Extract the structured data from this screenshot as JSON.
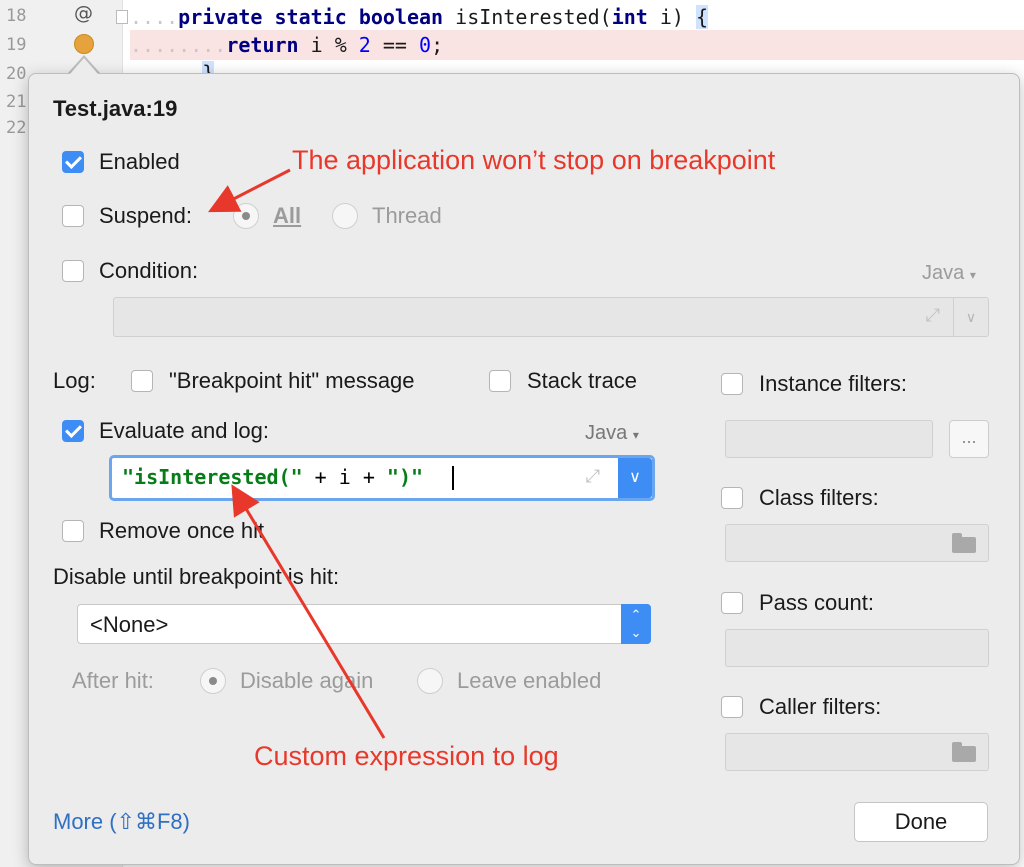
{
  "editor": {
    "line_numbers": [
      "18",
      "19",
      "20",
      "21",
      "22"
    ],
    "line18": {
      "kw1": "private",
      "kw2": "static",
      "kw3": "boolean",
      "name": "isInterested(",
      "kw4": "int",
      "rest": " i)",
      "brace": "{"
    },
    "line19": {
      "kw": "return",
      "rest": " i % ",
      "num1": "2",
      "eq": " == ",
      "num2": "0",
      "end": ";"
    },
    "line20": {
      "brace": "}"
    }
  },
  "dialog": {
    "title": "Test.java:19",
    "enabled_label": "Enabled",
    "suspend_label": "Suspend:",
    "suspend_all": "All",
    "suspend_thread": "Thread",
    "condition_label": "Condition:",
    "condition_lang": "Java",
    "log_label": "Log:",
    "log_breakpoint_hit": "\"Breakpoint hit\" message",
    "log_stack_trace": "Stack trace",
    "evaluate_label": "Evaluate and log:",
    "evaluate_lang": "Java",
    "evaluate_expression": {
      "part1": "\"isInterested(\"",
      "part2": " + ",
      "part3": "i",
      "part4": " + ",
      "part5": "\")\""
    },
    "remove_once_hit": "Remove once hit",
    "disable_until_label": "Disable until breakpoint is hit:",
    "disable_until_value": "<None>",
    "after_hit_label": "After hit:",
    "after_hit_disable": "Disable again",
    "after_hit_leave": "Leave enabled",
    "instance_filters": "Instance filters:",
    "ellipsis": "...",
    "class_filters": "Class filters:",
    "pass_count": "Pass count:",
    "caller_filters": "Caller filters:",
    "more_link": "More (⇧⌘F8)",
    "done_button": "Done"
  },
  "annotations": {
    "top": "The application won’t stop on breakpoint",
    "bottom": "Custom expression to log"
  },
  "colors": {
    "accent": "#3d8df5",
    "annotation": "#e8382b",
    "link": "#2f6fc4"
  }
}
